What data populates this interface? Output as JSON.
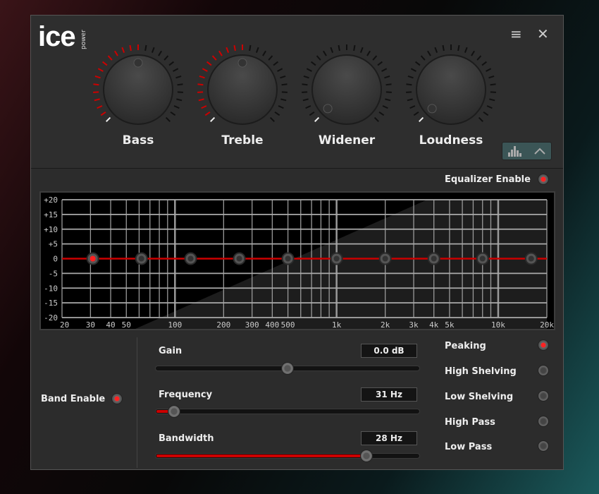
{
  "app": {
    "logo": "ice",
    "logo_sub": "power"
  },
  "header": {
    "menu_icon": "hamburger-menu-icon",
    "close_icon": "close-icon",
    "close_label": "✕",
    "menu_label": "≡"
  },
  "knobs": [
    {
      "label": "Bass",
      "value": 0.5
    },
    {
      "label": "Treble",
      "value": 0.5
    },
    {
      "label": "Widener",
      "value": 0
    },
    {
      "label": "Loudness",
      "value": 0
    }
  ],
  "eq_toggle": {
    "icon": "equalizer-bars-icon",
    "chevron": "chevron-up-icon"
  },
  "equalizer_enable": {
    "label": "Equalizer Enable",
    "on": true
  },
  "graph": {
    "y_ticks": [
      "+20",
      "+15",
      "+10",
      "+5",
      "0",
      "-5",
      "-10",
      "-15",
      "-20"
    ],
    "x_ticks": [
      "20",
      "30",
      "40",
      "50",
      "100",
      "200",
      "300",
      "400",
      "500",
      "1k",
      "2k",
      "3k",
      "4k",
      "5k",
      "10k",
      "20k"
    ],
    "bands_hz": [
      31,
      62,
      125,
      250,
      500,
      1000,
      2000,
      4000,
      8000,
      16000
    ],
    "gains_db": [
      0,
      0,
      0,
      0,
      0,
      0,
      0,
      0,
      0,
      0
    ],
    "selected_band": 0,
    "curve_color": "#cc0000"
  },
  "band_enable": {
    "label": "Band Enable",
    "on": true
  },
  "controls": {
    "gain": {
      "label": "Gain",
      "value": "0.0 dB",
      "fraction": 0.5
    },
    "frequency": {
      "label": "Frequency",
      "value": "31 Hz",
      "fraction": 0.07
    },
    "bandwidth": {
      "label": "Bandwidth",
      "value": "28 Hz",
      "fraction": 0.8
    }
  },
  "filter_types": [
    {
      "label": "Peaking",
      "on": true
    },
    {
      "label": "High Shelving",
      "on": false
    },
    {
      "label": "Low Shelving",
      "on": false
    },
    {
      "label": "High Pass",
      "on": false
    },
    {
      "label": "Low Pass",
      "on": false
    }
  ]
}
